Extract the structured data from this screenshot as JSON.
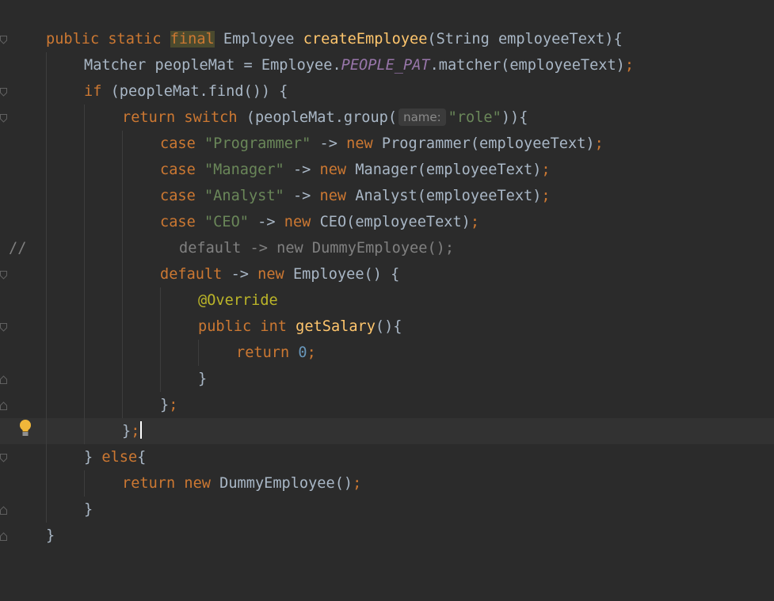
{
  "editor": {
    "lines": {
      "l1": {
        "kw1": "public static",
        "final": "final",
        "type": "Employee",
        "fn": "createEmployee",
        "params": "(String employeeText){"
      },
      "l2": {
        "pre": "Matcher peopleMat = Employee.",
        "static": "PEOPLE_PAT",
        "post": ".matcher(employeeText)",
        "semi": ";"
      },
      "l3": {
        "kw": "if",
        "rest": "(peopleMat.find()) {"
      },
      "l4": {
        "kw1": "return",
        "kw2": "switch",
        "pre": "(peopleMat.group(",
        "hint": "name:",
        "str": "\"role\"",
        "post": ")){"
      },
      "l5": {
        "kw": "case",
        "str": "\"Programmer\"",
        "arrow": "->",
        "new": "new",
        "rest": "Programmer(employeeText)",
        "semi": ";"
      },
      "l6": {
        "kw": "case",
        "str": "\"Manager\"",
        "arrow": "->",
        "new": "new",
        "rest": "Manager(employeeText)",
        "semi": ";"
      },
      "l7": {
        "kw": "case",
        "str": "\"Analyst\"",
        "arrow": "->",
        "new": "new",
        "rest": "Analyst(employeeText)",
        "semi": ";"
      },
      "l8": {
        "kw": "case",
        "str": "\"CEO\"",
        "arrow": "->",
        "new": "new",
        "rest": "CEO(employeeText)",
        "semi": ";"
      },
      "l9": {
        "marker": "//",
        "text": "default -> new DummyEmployee();"
      },
      "l10": {
        "kw": "default",
        "arrow": "->",
        "new": "new",
        "rest": "Employee() {"
      },
      "l11": {
        "ann": "@Override"
      },
      "l12": {
        "kw1": "public",
        "kw2": "int",
        "fn": "getSalary",
        "rest": "(){"
      },
      "l13": {
        "kw": "return",
        "num": "0",
        "semi": ";"
      },
      "l14": {
        "text": "}"
      },
      "l15": {
        "text": "}",
        "semi": ";"
      },
      "l16": {
        "text": "}",
        "semi": ";"
      },
      "l17": {
        "pre": "} ",
        "kw": "else",
        "rest": "{"
      },
      "l18": {
        "kw1": "return",
        "kw2": "new",
        "rest": "DummyEmployee()",
        "semi": ";"
      },
      "l19": {
        "text": "}"
      },
      "l20": {
        "text": "}"
      }
    },
    "colors": {
      "background": "#2b2b2b",
      "current_line": "#323232",
      "keyword": "#cc7832",
      "function": "#ffc66d",
      "string": "#6a8759",
      "number": "#6897bb",
      "static_field": "#9876aa",
      "annotation": "#bbb529",
      "comment": "#808080",
      "default_text": "#a9b7c6"
    },
    "icons": {
      "intention": "lightbulb-icon",
      "fold": "fold-marker-icon"
    }
  }
}
